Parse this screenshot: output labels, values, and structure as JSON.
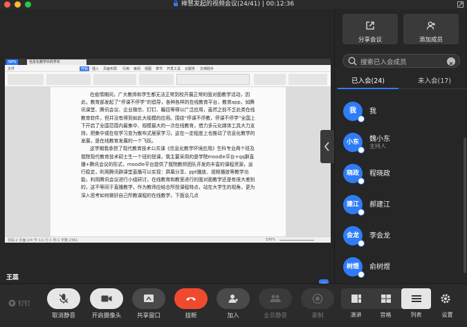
{
  "title": {
    "text": "禅慧发起的视频会议(24/41) | 00:12:36"
  },
  "wps": {
    "tabs": [
      "WPS",
      "信息化教学外的学年"
    ],
    "menu": [
      "文件",
      "开始",
      "插入",
      "页面布局",
      "引用",
      "审阅",
      "视图",
      "章节",
      "开发工具",
      "云服务",
      "文档助手"
    ],
    "status_text": "页码:2 页面:2/4 节:1/1 行:1 列:1 字数:2361",
    "zoom_text": "100%"
  },
  "document": {
    "paragraphs": [
      "在疫情期间，广大教师和学生都无法正常到校开展正常的面对面教学活动，因此，教育部发起了“停课不停学”的倡导，各种各样的在线教育平台，教育app，如腾讯课堂、腾讯会议、企业微信、钉钉、瞩目等得以广泛应用，虽然之前不乏此类在线教育软件，但并没有得到如此大规模的应用。围绕“停课不停教，停课不停学”全国上下开启了全国范围内最集中、规模最大的一次在线教育，借力多元化媒体工具大力支持，把集中或在校学习变为散布式居家学习，这在一定程度上也推动了信息化教学的发展，是在线教育发展的一个飞跃。",
      "这学期我承担了现代教育技术公共课《信息化教学环境应用》生科专业两个班及我院现代教育技术硕士生一个班的授课，我主要采用的是学院moodle平台+qq群直播+腾讯会议的形式，moodle平台提供了我院教师团队开发的丰富的课程资源，运行稳定，利用腾讯群课堂直播可以实现：屏幕分享、ppt播放、视频播放等教学功能，利用腾讯会议进行小组研讨，在线教育和教室进行的面对面教学还是有很大差别的，这不等同于直播教学，作为教师应结合所授课程特点，站在大学生的视角，更为深入思考如何做好自己所教课程的在线教学，下面谈几点"
    ]
  },
  "stage": {
    "speaker_name": "王蕊"
  },
  "sidebar": {
    "share_label": "分享会议",
    "add_label": "添加成员",
    "search_placeholder": "搜索已入会成员",
    "tab_joined": "已入会(24)",
    "tab_not_joined": "未入会(17)",
    "members": [
      {
        "avatar": "我",
        "name": "我",
        "sub": ""
      },
      {
        "avatar": "小东",
        "name": "魏小东",
        "sub": "主持人"
      },
      {
        "avatar": "晓政",
        "name": "程晓政",
        "sub": ""
      },
      {
        "avatar": "建江",
        "name": "郝建江",
        "sub": ""
      },
      {
        "avatar": "会龙",
        "name": "李会龙",
        "sub": ""
      },
      {
        "avatar": "树煜",
        "name": "俞树煜",
        "sub": ""
      }
    ]
  },
  "toolbar": {
    "brand": "钉钉",
    "mute_label": "取消静音",
    "camera_label": "开启摄像头",
    "share_window_label": "共享窗口",
    "hangup_label": "挂断",
    "join_label": "加入",
    "mute_all_label": "全员静音",
    "record_label": "录制",
    "view_speaker": "演讲",
    "view_grid": "宫格",
    "view_list": "列表",
    "settings_label": "设置"
  },
  "colors": {
    "accent": "#2f7cf6",
    "hangup": "#f04a2e",
    "bg": "#262626"
  }
}
